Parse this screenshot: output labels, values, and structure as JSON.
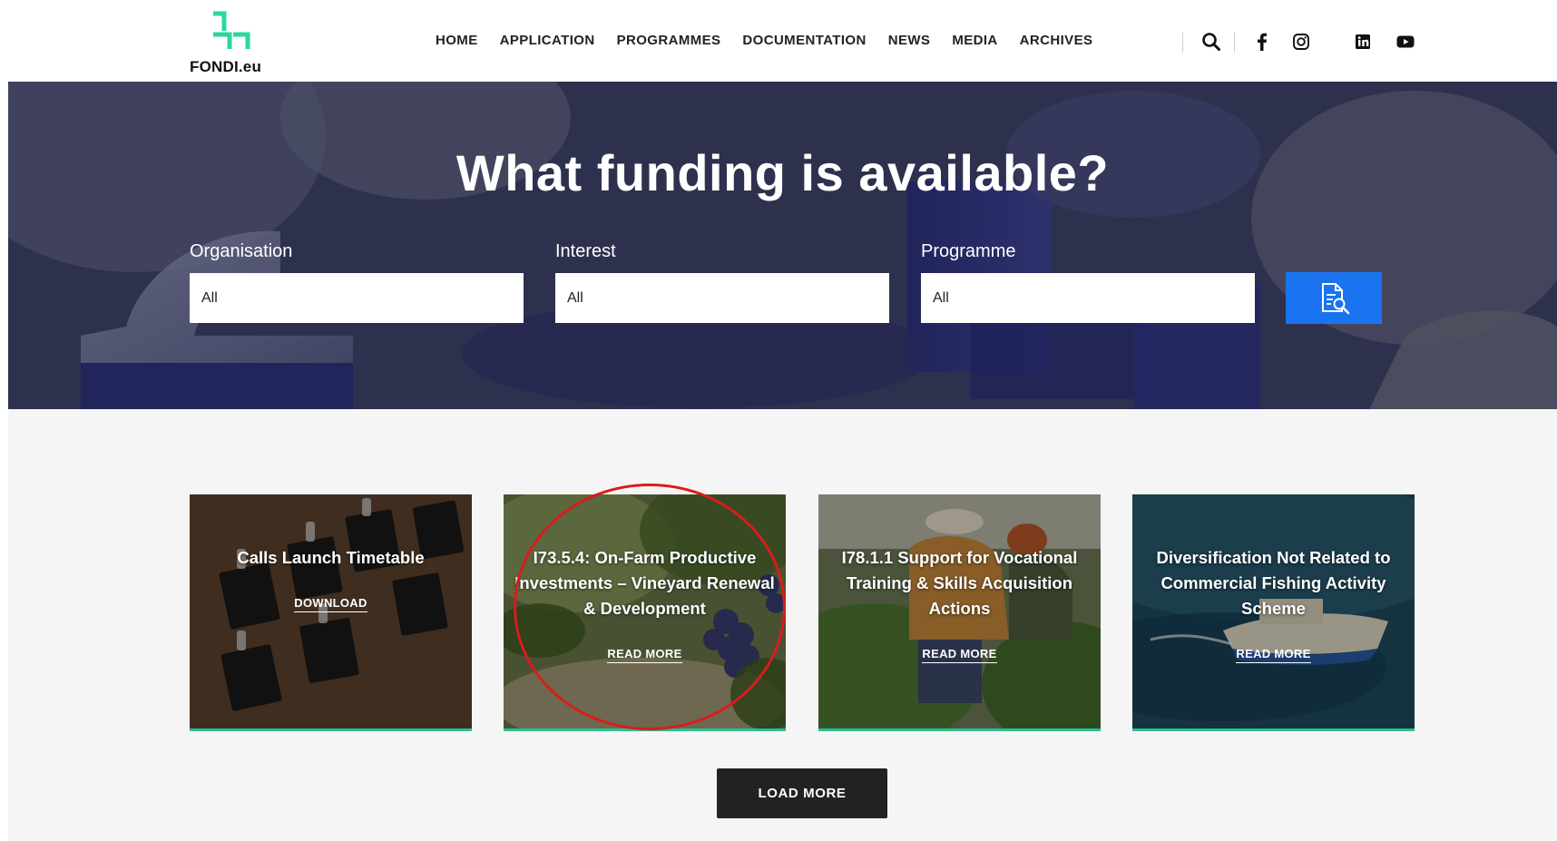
{
  "brand": {
    "logo_text": "FONDI.eu",
    "accent": "#2bd7a0"
  },
  "nav": {
    "items": [
      "HOME",
      "APPLICATION",
      "PROGRAMMES",
      "DOCUMENTATION",
      "NEWS",
      "MEDIA",
      "ARCHIVES"
    ]
  },
  "header_icons": [
    "search-icon",
    "facebook-icon",
    "instagram-icon",
    "linkedin-icon",
    "youtube-icon"
  ],
  "hero": {
    "title": "What funding is available?",
    "filters": [
      {
        "label": "Organisation",
        "value": "All"
      },
      {
        "label": "Interest",
        "value": "All"
      },
      {
        "label": "Programme",
        "value": "All"
      }
    ],
    "search_button_color": "#1a73f0"
  },
  "cards": [
    {
      "title": "Calls Launch Timetable",
      "link": "DOWNLOAD"
    },
    {
      "title": "I73.5.4: On-Farm Productive Investments – Vineyard Renewal & Development",
      "link": "READ MORE"
    },
    {
      "title": "I78.1.1 Support for Vocational Training & Skills Acquisition Actions",
      "link": "READ MORE"
    },
    {
      "title": "Diversification Not Related to Commercial Fishing Activity Scheme",
      "link": "READ MORE"
    }
  ],
  "load_more": "LOAD MORE",
  "highlight_color": "#d91c1c"
}
